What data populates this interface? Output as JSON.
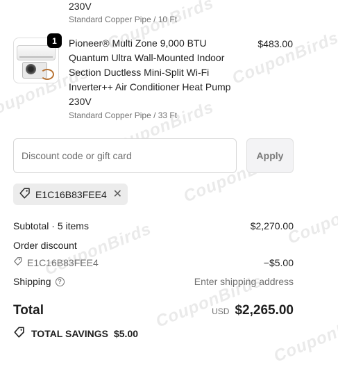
{
  "watermark": "CouponBirds",
  "items": [
    {
      "name_tail": "230V",
      "variant": "Standard Copper Pipe / 10 Ft"
    },
    {
      "quantity": "1",
      "name": "Pioneer® Multi Zone 9,000 BTU Quantum Ultra Wall-Mounted Indoor Section Ductless Mini-Split Wi-Fi Inverter++ Air Conditioner Heat Pump 230V",
      "variant": "Standard Copper Pipe / 33 Ft",
      "price": "$483.00"
    }
  ],
  "discount": {
    "placeholder": "Discount code or gift card",
    "value": "",
    "apply_label": "Apply",
    "applied_code": "E1C16B83FEE4"
  },
  "summary": {
    "subtotal_label": "Subtotal · 5 items",
    "subtotal_value": "$2,270.00",
    "order_discount_label": "Order discount",
    "discount_code": "E1C16B83FEE4",
    "discount_value": "−$5.00",
    "shipping_label": "Shipping",
    "shipping_value": "Enter shipping address",
    "total_label": "Total",
    "currency": "USD",
    "total_value": "$2,265.00",
    "savings_label": "TOTAL SAVINGS",
    "savings_value": "$5.00"
  },
  "colors": {
    "text": "#1f1f1f",
    "muted": "#707070",
    "chip_bg": "#ececec",
    "badge_bg": "#000000"
  },
  "icons": [
    "tag-icon",
    "close-icon",
    "help-icon"
  ]
}
